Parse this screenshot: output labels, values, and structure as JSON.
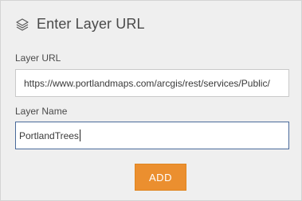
{
  "header": {
    "icon": "layers-icon",
    "title": "Enter Layer URL"
  },
  "form": {
    "layer_url": {
      "label": "Layer URL",
      "value": "https://www.portlandmaps.com/arcgis/rest/services/Public/"
    },
    "layer_name": {
      "label": "Layer Name",
      "value": "PortlandTrees"
    }
  },
  "actions": {
    "add_label": "ADD"
  },
  "colors": {
    "panel_bg": "#efefef",
    "accent": "#eb8f2f",
    "focus_border": "#4a6a9a"
  }
}
